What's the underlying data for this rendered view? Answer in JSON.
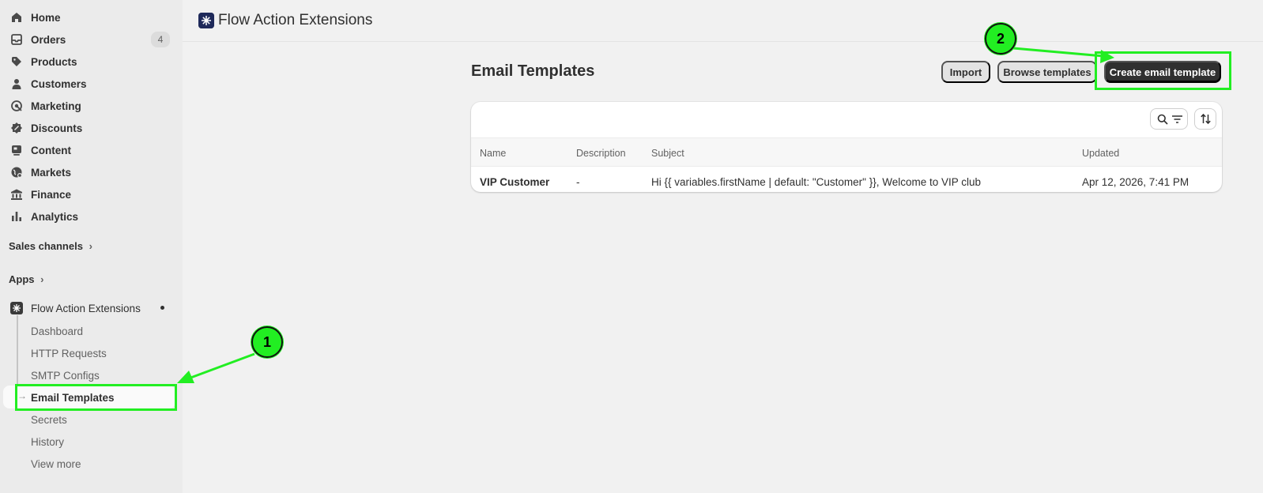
{
  "sidebar": {
    "items": [
      {
        "label": "Home",
        "icon": "home-icon"
      },
      {
        "label": "Orders",
        "icon": "inbox-icon",
        "badge": "4"
      },
      {
        "label": "Products",
        "icon": "tag-icon"
      },
      {
        "label": "Customers",
        "icon": "person-icon"
      },
      {
        "label": "Marketing",
        "icon": "target-icon"
      },
      {
        "label": "Discounts",
        "icon": "discount-icon"
      },
      {
        "label": "Content",
        "icon": "content-icon"
      },
      {
        "label": "Markets",
        "icon": "globe-icon"
      },
      {
        "label": "Finance",
        "icon": "bank-icon"
      },
      {
        "label": "Analytics",
        "icon": "bar-chart-icon"
      }
    ],
    "sales_channels": "Sales channels",
    "apps": "Apps",
    "app_name": "Flow Action Extensions",
    "sub_items": [
      "Dashboard",
      "HTTP Requests",
      "SMTP Configs",
      "Email Templates",
      "Secrets",
      "History",
      "View more"
    ]
  },
  "header": {
    "title": "Flow Action Extensions"
  },
  "page": {
    "title": "Email Templates",
    "import_label": "Import",
    "browse_label": "Browse templates",
    "create_label": "Create email template"
  },
  "table": {
    "columns": [
      "Name",
      "Description",
      "Subject",
      "Updated"
    ],
    "rows": [
      {
        "name": "VIP Customer",
        "description": "-",
        "subject": "Hi {{ variables.firstName | default: \"Customer\" }}, Welcome to VIP club",
        "updated": "Apr 12, 2026, 7:41 PM"
      }
    ]
  },
  "annotations": {
    "marker1": "1",
    "marker2": "2",
    "color": "#22ee22"
  }
}
